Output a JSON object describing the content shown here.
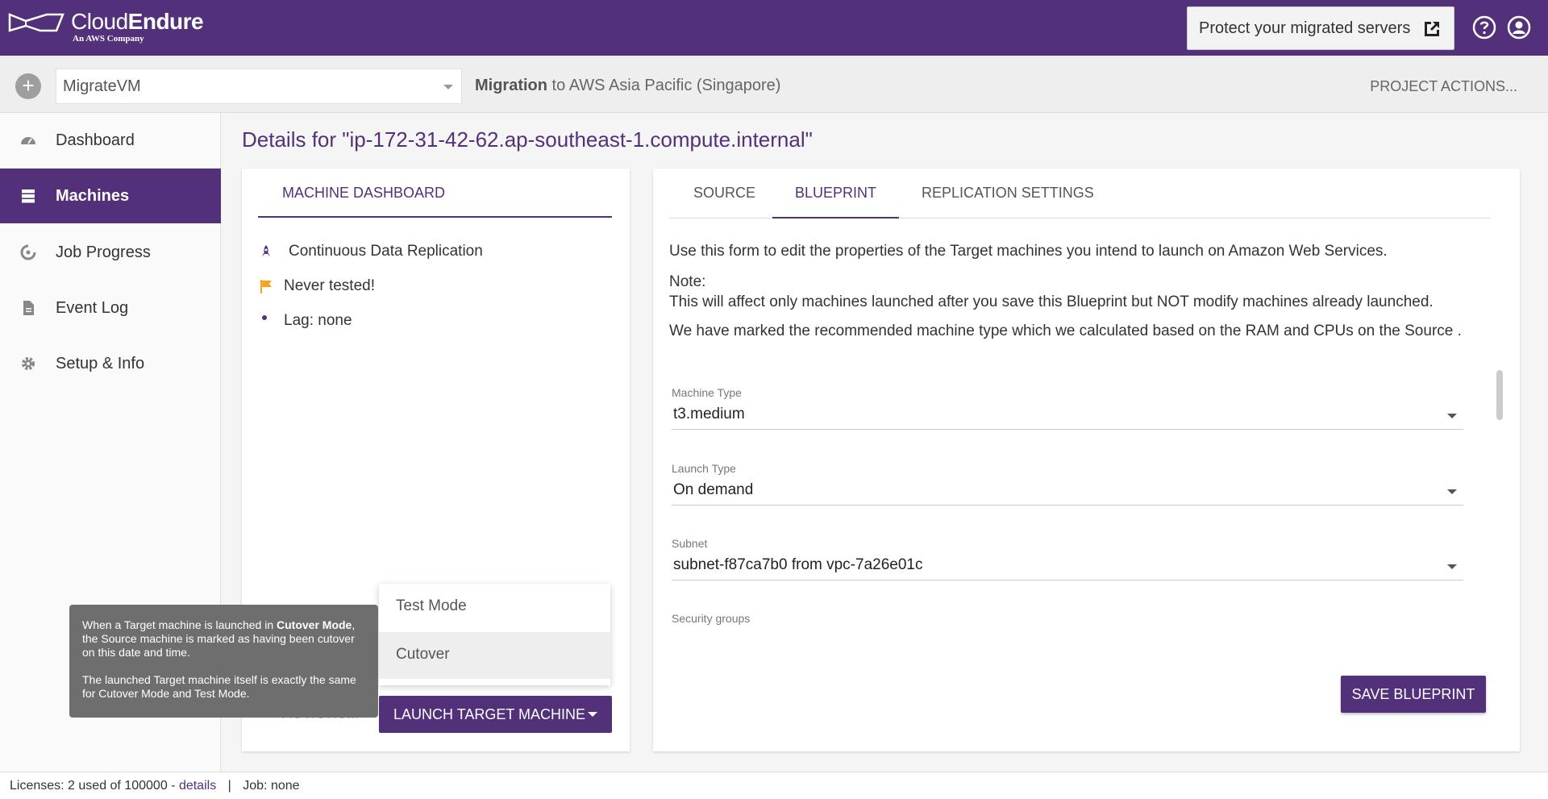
{
  "header": {
    "logo_main_regular": "Cloud",
    "logo_main_bold": "Endure",
    "logo_sub": "An AWS Company",
    "protect_button": "Protect your migrated servers",
    "icons": [
      "external-link-icon",
      "help-icon",
      "user-icon"
    ],
    "bg_color": "#52317a"
  },
  "project_bar": {
    "project_name": "MigrateVM",
    "migration_bold": "Migration",
    "migration_rest": " to AWS Asia Pacific (Singapore)",
    "actions": "PROJECT ACTIONS..."
  },
  "sidebar": {
    "items": [
      {
        "label": "Dashboard",
        "icon": "gauge-icon"
      },
      {
        "label": "Machines",
        "icon": "server-icon",
        "active": true
      },
      {
        "label": "Job Progress",
        "icon": "progress-icon"
      },
      {
        "label": "Event Log",
        "icon": "document-icon"
      },
      {
        "label": "Setup & Info",
        "icon": "gear-icon"
      }
    ]
  },
  "main": {
    "title": "Details for \"ip-172-31-42-62.ap-southeast-1.compute.internal\"",
    "left_card": {
      "tab": "MACHINE DASHBOARD",
      "status": [
        {
          "icon": "rocket-icon",
          "text": "Continuous Data Replication"
        },
        {
          "icon": "flag-icon",
          "text": "Never tested!"
        },
        {
          "icon": "dot-icon",
          "text": "Lag: none"
        }
      ],
      "actions": "ACTIONS...",
      "launch_button": "LAUNCH TARGET MACHINE",
      "dropdown": [
        "Test Mode",
        "Cutover"
      ]
    },
    "tooltip": {
      "p1_a": "When a Target machine is launched in ",
      "p1_b": "Cutover Mode",
      "p1_c": ", the Source machine is marked as having been cutover on this date and time.",
      "p2": "The launched Target machine itself is exactly the same for Cutover Mode and Test Mode."
    },
    "right_card": {
      "tabs": [
        "SOURCE",
        "BLUEPRINT",
        "REPLICATION SETTINGS"
      ],
      "active_tab": "BLUEPRINT",
      "intro": "Use this form to edit the properties of the Target machines you intend to launch on Amazon Web Services.",
      "note_label": "Note:",
      "note_text": "This will affect only machines launched after you save this Blueprint but NOT modify machines already launched.",
      "recommend": "We have marked the recommended machine type which we calculated based on the RAM and CPUs on the Source .",
      "fields": [
        {
          "label": "Machine Type",
          "value": "t3.medium"
        },
        {
          "label": "Launch Type",
          "value": "On demand"
        },
        {
          "label": "Subnet",
          "value": "subnet-f87ca7b0 from vpc-7a26e01c"
        },
        {
          "label": "Security groups",
          "value": ""
        }
      ],
      "save_button": "SAVE BLUEPRINT"
    }
  },
  "status_bar": {
    "licenses_label": "Licenses:",
    "licenses_value": "2 used of 100000 -",
    "details_link": "details",
    "separator": "|",
    "job_label": "Job:",
    "job_value": "none"
  }
}
